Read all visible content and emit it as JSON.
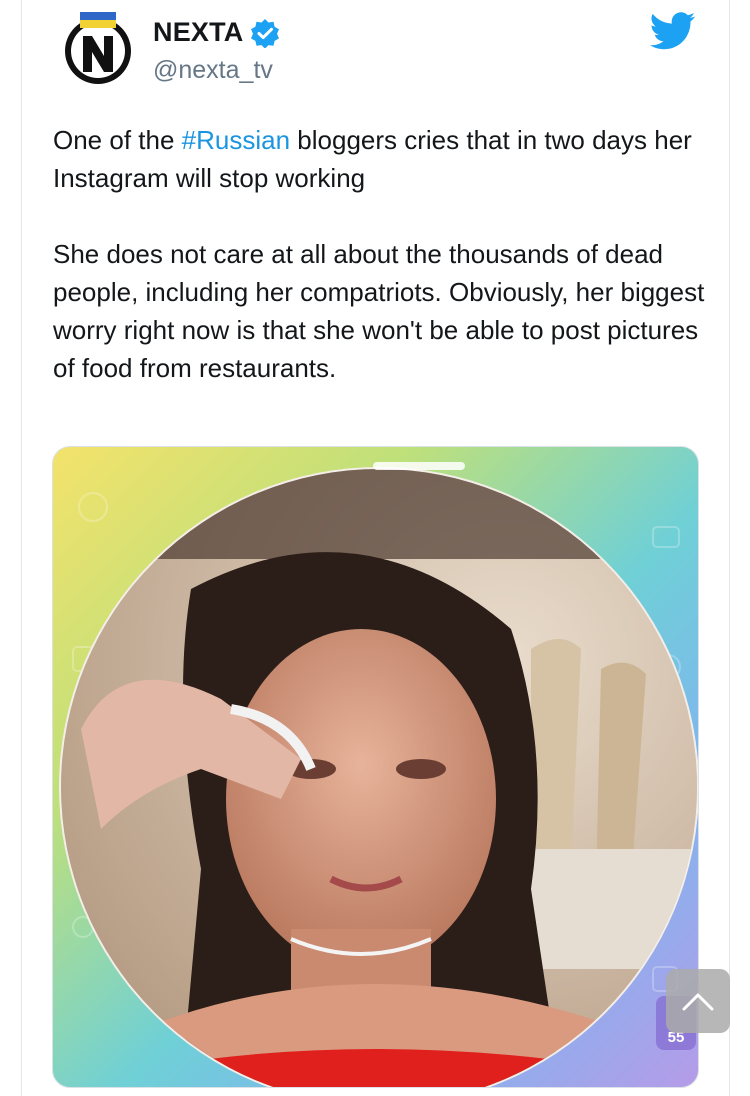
{
  "tweet": {
    "author_name": "NEXTA",
    "author_handle": "@nexta_tv",
    "text_before_hashtag": "One of the ",
    "hashtag": "#Russian",
    "text_after_hashtag": " bloggers cries that in two days her Instagram will stop working",
    "paragraph_2": "She does not care at all about the thousands of dead people, including her compatriots. Obviously, her biggest worry right now is that she won't be able to post pictures of food from restaurants."
  },
  "media": {
    "badge_count": "55"
  },
  "icons": {
    "verified": "verified-badge-icon",
    "twitter": "twitter-bird-icon",
    "scroll_top": "chevron-up-icon"
  },
  "colors": {
    "link": "#1b95e0",
    "twitter_blue": "#1da1f2",
    "text": "#14171a",
    "handle": "#657786",
    "avatar_flag_yellow": "#f2d233",
    "avatar_flag_blue": "#2f67c9"
  }
}
